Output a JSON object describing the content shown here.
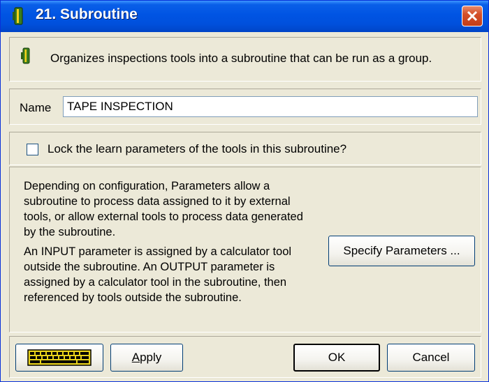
{
  "window": {
    "title": "21. Subroutine",
    "title_icon": "plug-icon",
    "close_icon": "close-x-icon"
  },
  "description": {
    "icon": "plug-icon",
    "text": "Organizes inspections tools into a subroutine that can be run as a group."
  },
  "name": {
    "label": "Name",
    "value": "TAPE INSPECTION"
  },
  "lock": {
    "label": "Lock the learn parameters of the tools in this subroutine?",
    "checked": false
  },
  "parameters": {
    "paragraph1": "Depending on configuration, Parameters allow a subroutine to process data assigned to it by external tools, or allow external tools to process data generated by the subroutine.",
    "paragraph2": "An INPUT parameter is assigned by a calculator tool outside the subroutine.  An OUTPUT parameter is assigned by a calculator tool in the subroutine, then referenced by tools outside the subroutine.",
    "specify_button": "Specify Parameters ..."
  },
  "buttons": {
    "keyboard_icon": "keyboard-icon",
    "apply": "Apply",
    "ok": "OK",
    "cancel": "Cancel"
  },
  "colors": {
    "titlebar": "#0054e3",
    "dialog_bg": "#ece9d8",
    "close_button": "#d4502a"
  }
}
